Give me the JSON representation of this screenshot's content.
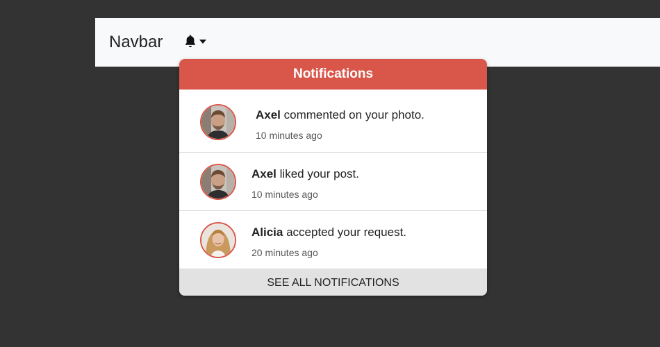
{
  "navbar": {
    "brand": "Navbar",
    "bell_icon": "bell-icon"
  },
  "dropdown": {
    "title": "Notifications",
    "items": [
      {
        "name": "Axel",
        "message": " commented on your photo.",
        "time": "10 minutes ago",
        "avatar": "man-avatar"
      },
      {
        "name": "Axel",
        "message": " liked your post.",
        "time": "10 minutes ago",
        "avatar": "man-avatar"
      },
      {
        "name": "Alicia",
        "message": " accepted your request.",
        "time": "20 minutes ago",
        "avatar": "woman-avatar"
      }
    ],
    "footer": "SEE ALL NOTIFICATIONS"
  },
  "colors": {
    "accent": "#d9574a",
    "background": "#333333",
    "navbar": "#f8f9fa",
    "footer": "#e2e2e2"
  }
}
